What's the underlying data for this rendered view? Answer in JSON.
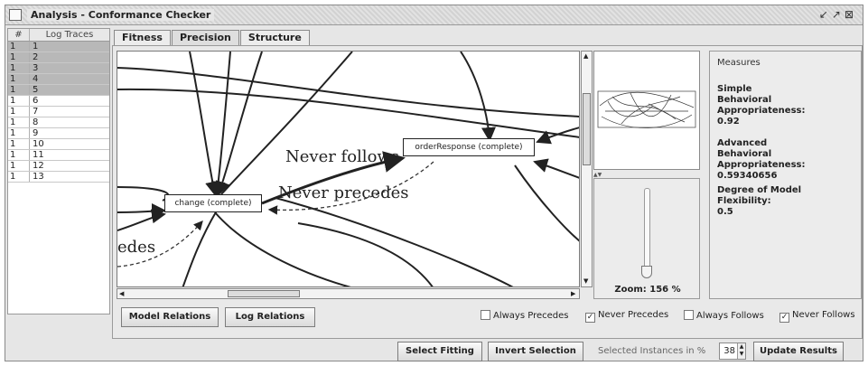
{
  "window": {
    "title": "Analysis - Conformance Checker",
    "controls": [
      "minimize-icon",
      "maximize-icon",
      "close-icon"
    ]
  },
  "traces": {
    "headers": [
      "#",
      "Log Traces"
    ],
    "rows": [
      {
        "num": "1",
        "trace": "1",
        "selected": true
      },
      {
        "num": "1",
        "trace": "2",
        "selected": true
      },
      {
        "num": "1",
        "trace": "3",
        "selected": true
      },
      {
        "num": "1",
        "trace": "4",
        "selected": true
      },
      {
        "num": "1",
        "trace": "5",
        "selected": true
      },
      {
        "num": "1",
        "trace": "6",
        "selected": false
      },
      {
        "num": "1",
        "trace": "7",
        "selected": false
      },
      {
        "num": "1",
        "trace": "8",
        "selected": false
      },
      {
        "num": "1",
        "trace": "9",
        "selected": false
      },
      {
        "num": "1",
        "trace": "10",
        "selected": false
      },
      {
        "num": "1",
        "trace": "11",
        "selected": false
      },
      {
        "num": "1",
        "trace": "12",
        "selected": false
      },
      {
        "num": "1",
        "trace": "13",
        "selected": false
      }
    ]
  },
  "tabs": [
    {
      "label": "Fitness",
      "active": false
    },
    {
      "label": "Precision",
      "active": true
    },
    {
      "label": "Structure",
      "active": false
    }
  ],
  "graph": {
    "nodes": {
      "order_response": "orderResponse (complete)",
      "change": "change (complete)"
    },
    "edge_labels": {
      "never_follows": "Never follows",
      "never_precedes": "Never precedes",
      "partial": "edes"
    }
  },
  "zoom": {
    "label": "Zoom: 156 %",
    "level_percent": 156
  },
  "measures": {
    "title": "Measures",
    "simple_heading": "Simple",
    "simple_metric": "Behavioral Appropriateness:",
    "simple_value": "0.92",
    "advanced_heading": "Advanced",
    "advanced_metric": "Behavioral Appropriateness:",
    "advanced_value": "0.59340656",
    "flexibility_metric": "Degree of Model Flexibility:",
    "flexibility_value": "0.5"
  },
  "relation_buttons": {
    "model": "Model Relations",
    "log": "Log Relations"
  },
  "filters": [
    {
      "label": "Always Precedes",
      "checked": false
    },
    {
      "label": "Never Precedes",
      "checked": true
    },
    {
      "label": "Always Follows",
      "checked": false
    },
    {
      "label": "Never Follows",
      "checked": true
    }
  ],
  "footer": {
    "select_fitting": "Select Fitting",
    "invert_selection": "Invert Selection",
    "instances_label": "Selected Instances in %",
    "instances_value": "38",
    "update_results": "Update Results"
  },
  "colors": {
    "window_bg": "#e6e6e6",
    "selected_row": "#b8b8b8",
    "edge": "#222222"
  }
}
